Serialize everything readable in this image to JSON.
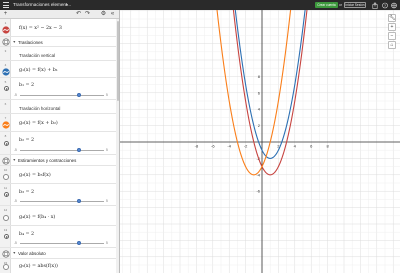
{
  "app": {
    "title": "Transformaciones element...",
    "title_chevron": "▾",
    "save_label": "Crear cuenta",
    "save_caret": "or",
    "login_label": "Iniciar Sesión"
  },
  "toolbar": {
    "add_label": "+",
    "undo_label": "↶",
    "redo_label": "↷",
    "settings_label": "⚙",
    "collapse_label": "«"
  },
  "expressions": [
    {
      "kind": "expr",
      "num": "1",
      "latex": "f(x) = x² − 2x − 3",
      "color": "#c74440"
    },
    {
      "kind": "folder",
      "num": "2",
      "label": "Traslaciones"
    },
    {
      "kind": "note",
      "num": "3",
      "text": "Traslación vertical"
    },
    {
      "kind": "expr",
      "num": "4",
      "latex": "g₁(x) = f(x) + b₁",
      "color": "#2d70b3"
    },
    {
      "kind": "slider",
      "num": "5",
      "latex": "b₁ = 2",
      "min": "-5",
      "max": "5",
      "value": 0.7
    },
    {
      "kind": "note",
      "num": "6",
      "text": "Traslación horizontal"
    },
    {
      "kind": "expr",
      "num": "7",
      "latex": "g₂(x) = f(x + b₂)",
      "color": "#fa7e19"
    },
    {
      "kind": "slider",
      "num": "8",
      "latex": "b₂ = 2",
      "min": "-5",
      "max": "5",
      "value": 0.7
    },
    {
      "kind": "folder",
      "num": "9",
      "label": "Estiramientos y contracciones"
    },
    {
      "kind": "expr",
      "num": "10",
      "latex": "g₃(x) = b₃f(x)",
      "color": null
    },
    {
      "kind": "slider",
      "num": "11",
      "latex": "b₃ = 2",
      "min": "-5",
      "max": "5",
      "value": 0.7
    },
    {
      "kind": "expr",
      "num": "12",
      "latex": "g₄(x) = f(b₄ · x)",
      "color": null
    },
    {
      "kind": "slider",
      "num": "13",
      "latex": "b₄ = 2",
      "min": "-5",
      "max": "5",
      "value": 0.7
    },
    {
      "kind": "folder",
      "num": "14",
      "label": "Valor absoluto"
    },
    {
      "kind": "expr",
      "num": "15",
      "latex": "g₅(x) = abs(f(x))",
      "color": null
    }
  ],
  "graph": {
    "x_ticks": [
      "-8",
      "-6",
      "-4",
      "-2",
      "2",
      "4",
      "6",
      "8"
    ],
    "y_ticks": [
      "8",
      "6",
      "4",
      "2",
      "-2",
      "-4",
      "-6"
    ],
    "curve_colors": {
      "f": "#c74440",
      "g1": "#2d70b3",
      "g2": "#fa7e19"
    }
  }
}
